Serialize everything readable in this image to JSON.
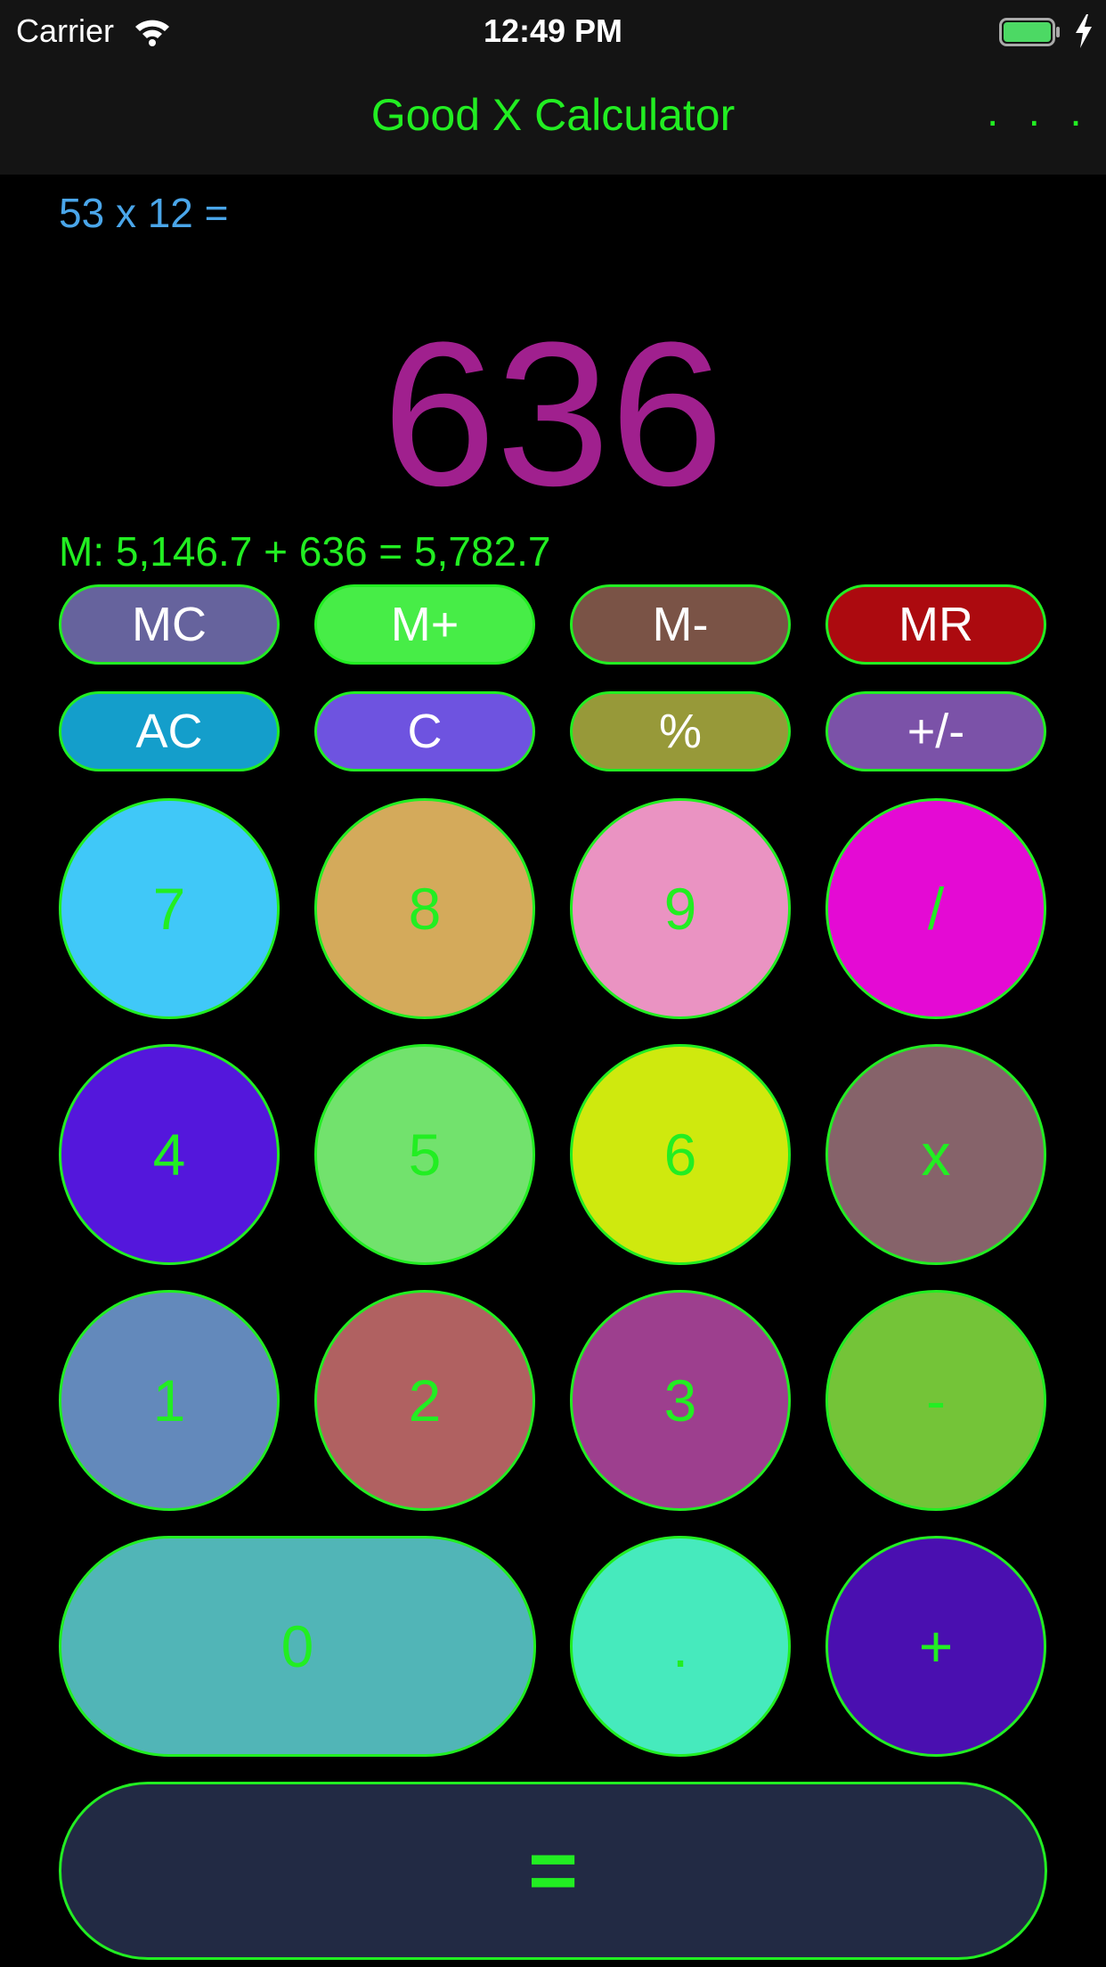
{
  "status_bar": {
    "carrier": "Carrier",
    "time": "12:49 PM"
  },
  "nav": {
    "title": "Good X Calculator",
    "more": ". . ."
  },
  "display": {
    "expression": "53 x 12 =",
    "result": "636",
    "memory": "M: 5,146.7 + 636 = 5,782.7"
  },
  "memory_buttons": [
    {
      "label": "MC",
      "color": "#66639d"
    },
    {
      "label": "M+",
      "color": "#47ed47"
    },
    {
      "label": "M-",
      "color": "#7a5346"
    },
    {
      "label": "MR",
      "color": "#ac0a0f"
    }
  ],
  "function_buttons": [
    {
      "label": "AC",
      "color": "#149ecb"
    },
    {
      "label": "C",
      "color": "#6e53e0"
    },
    {
      "label": "%",
      "color": "#979939"
    },
    {
      "label": "+/-",
      "color": "#7b52a8"
    }
  ],
  "keypad": [
    {
      "label": "7",
      "color": "#40c8f8"
    },
    {
      "label": "8",
      "color": "#d4aa5b"
    },
    {
      "label": "9",
      "color": "#ea93c2"
    },
    {
      "label": "/",
      "color": "#e40ad4"
    },
    {
      "label": "4",
      "color": "#5417dc"
    },
    {
      "label": "5",
      "color": "#72e26d"
    },
    {
      "label": "6",
      "color": "#cfe90e"
    },
    {
      "label": "x",
      "color": "#86636a"
    },
    {
      "label": "1",
      "color": "#6389bb"
    },
    {
      "label": "2",
      "color": "#b06161"
    },
    {
      "label": "3",
      "color": "#9d3f8e"
    },
    {
      "label": "-",
      "color": "#74c438"
    },
    {
      "label": "0",
      "color": "#51b5b7"
    },
    {
      "label": ".",
      "color": "#46eabd"
    },
    {
      "label": "+",
      "color": "#4a0fb0"
    }
  ],
  "equals": {
    "label": "=",
    "color": "#222a44"
  },
  "colors": {
    "accent": "#22ee22",
    "expression": "#4aa6ea",
    "result": "#a0208e",
    "background": "#000000",
    "nav_background": "#141414"
  },
  "icons": [
    "wifi-icon",
    "battery-icon",
    "charging-bolt-icon"
  ]
}
